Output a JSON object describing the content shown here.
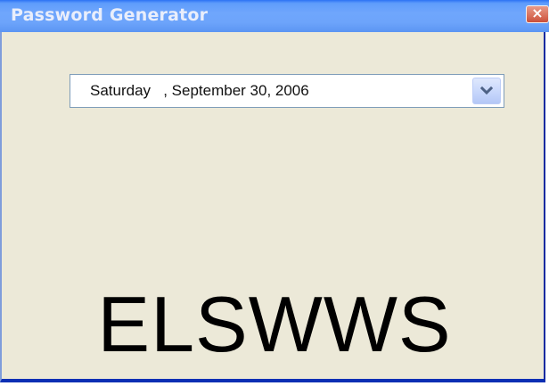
{
  "window": {
    "title": "Password Generator",
    "close_label": "×"
  },
  "date_picker": {
    "value": "Saturday   , September 30, 2006",
    "dropdown_icon": "chevron-down-icon"
  },
  "password": {
    "value": "ELSWWS"
  },
  "colors": {
    "titlebar": "#6fa6fc",
    "window_background": "#ece9d8",
    "close_button": "#d9705a",
    "password_text": "#000000"
  }
}
